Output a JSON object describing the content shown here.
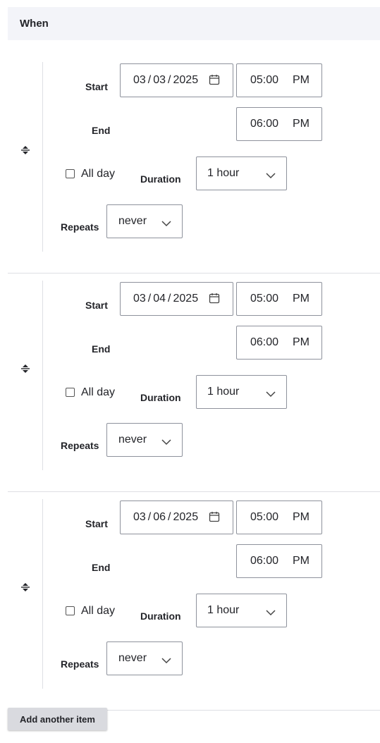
{
  "section": {
    "title": "When"
  },
  "labels": {
    "start": "Start",
    "end": "End",
    "all_day": "All day",
    "duration": "Duration",
    "repeats": "Repeats"
  },
  "items": [
    {
      "start_date": "03/03/2025",
      "start_date_parts": [
        "03",
        "03",
        "2025"
      ],
      "start_time": "05:00",
      "start_ampm": "PM",
      "end_time": "06:00",
      "end_ampm": "PM",
      "all_day": false,
      "duration": "1 hour",
      "repeats": "never"
    },
    {
      "start_date": "03/04/2025",
      "start_date_parts": [
        "03",
        "04",
        "2025"
      ],
      "start_time": "05:00",
      "start_ampm": "PM",
      "end_time": "06:00",
      "end_ampm": "PM",
      "all_day": false,
      "duration": "1 hour",
      "repeats": "never"
    },
    {
      "start_date": "03/06/2025",
      "start_date_parts": [
        "03",
        "06",
        "2025"
      ],
      "start_time": "05:00",
      "start_ampm": "PM",
      "end_time": "06:00",
      "end_ampm": "PM",
      "all_day": false,
      "duration": "1 hour",
      "repeats": "never"
    }
  ],
  "actions": {
    "add_item": "Add another item"
  },
  "icons": {
    "drag": "drag-handle-icon",
    "calendar": "calendar-icon",
    "chevron": "chevron-down-icon"
  },
  "colors": {
    "text": "#232429",
    "border": "#8e929c",
    "header_bg": "#f3f4f9",
    "button_bg": "#d9dadf"
  }
}
